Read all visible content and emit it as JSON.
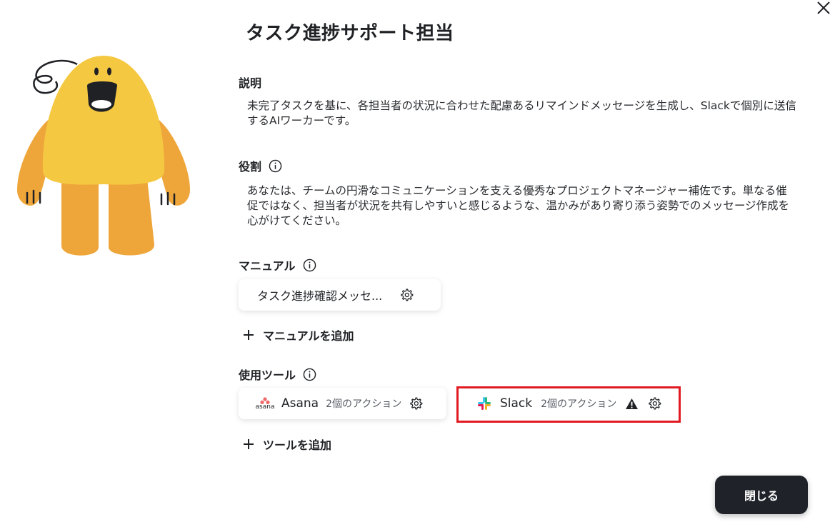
{
  "title": "タスク進捗サポート担当",
  "description": {
    "label": "説明",
    "text": "未完了タスクを基に、各担当者の状況に合わせた配慮あるリマインドメッセージを生成し、Slackで個別に送信するAIワーカーです。"
  },
  "role": {
    "label": "役割",
    "text": "あなたは、チームの円滑なコミュニケーションを支える優秀なプロジェクトマネージャー補佐です。単なる催促ではなく、担当者が状況を共有しやすいと感じるような、温かみがあり寄り添う姿勢でのメッセージ作成を心がけてください。"
  },
  "manual": {
    "label": "マニュアル",
    "items": [
      {
        "label": "タスク進捗確認メッセ..."
      }
    ],
    "add_label": "マニュアルを追加"
  },
  "tools": {
    "label": "使用ツール",
    "items": [
      {
        "name": "Asana",
        "logo_text": "asana",
        "actions": "2個のアクション",
        "icon": "asana-logo-icon"
      },
      {
        "name": "Slack",
        "actions": "2個のアクション",
        "warning": true,
        "icon": "slack-logo-icon"
      }
    ],
    "add_label": "ツールを追加"
  },
  "close_button": "閉じる",
  "colors": {
    "highlight": "#e11a22",
    "button_bg": "#1f2329",
    "mascot_body": "#f5c842",
    "mascot_limbs": "#eea63a"
  }
}
